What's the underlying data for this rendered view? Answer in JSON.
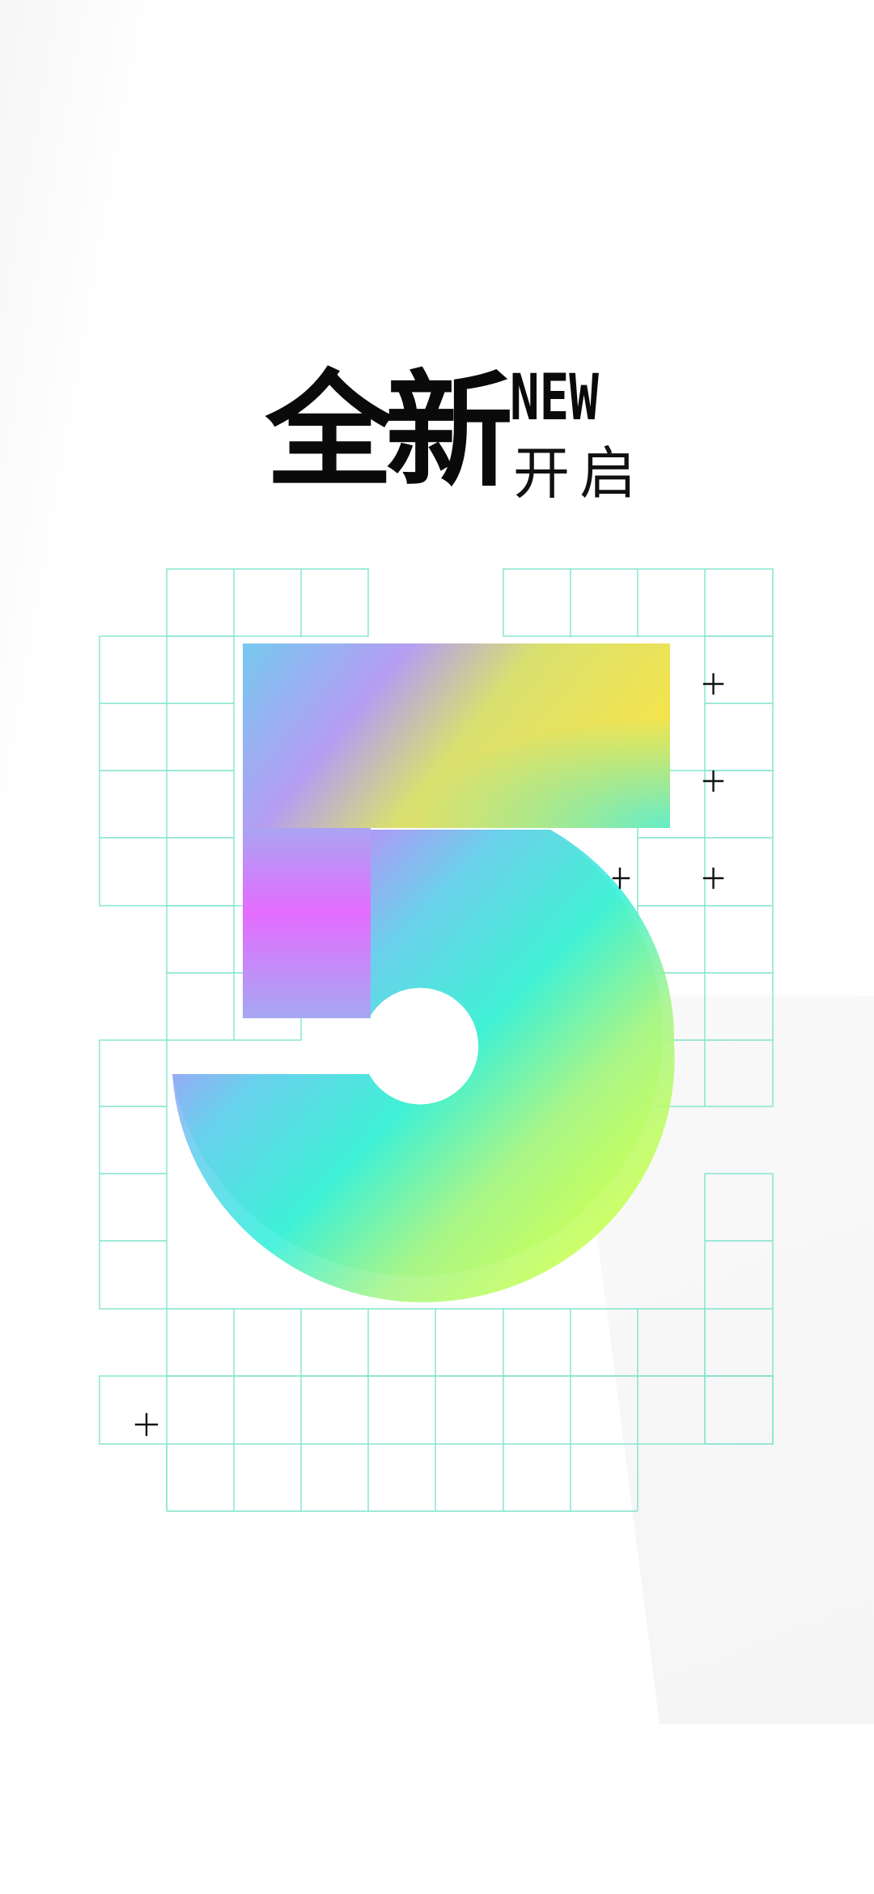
{
  "headline": {
    "main": "全新",
    "new_label": "NEW",
    "sub": "开启"
  },
  "hero": {
    "digit": "5"
  },
  "colors": {
    "grid": "#7fe3cc",
    "pink": "#e86cff",
    "cyan": "#2ff0e0",
    "yellow": "#f2e650",
    "lime": "#c4ff5a",
    "text": "#0a0a0a"
  }
}
